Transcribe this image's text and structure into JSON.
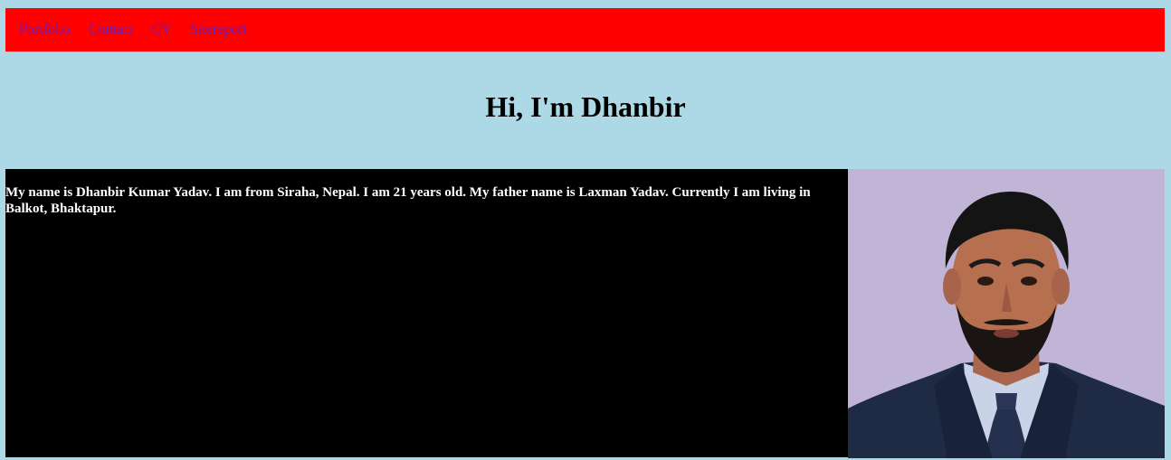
{
  "nav": {
    "items": [
      "Portfolio",
      "Contact",
      "CV",
      "Sitereport"
    ]
  },
  "hero": {
    "title": "Hi, I'm Dhanbir"
  },
  "about": {
    "text": "My name is Dhanbir Kumar Yadav. I am from Siraha, Nepal. I am 21 years old. My father name is Laxman Yadav. Currently I am living in Balkot, Bhaktapur."
  },
  "photo": {
    "alt": "profile-photo"
  },
  "colors": {
    "background": "#add8e6",
    "nav_bg": "#ff0000",
    "nav_link": "#6b1fb8",
    "content_bg": "#000000",
    "content_text": "#ffffff"
  }
}
